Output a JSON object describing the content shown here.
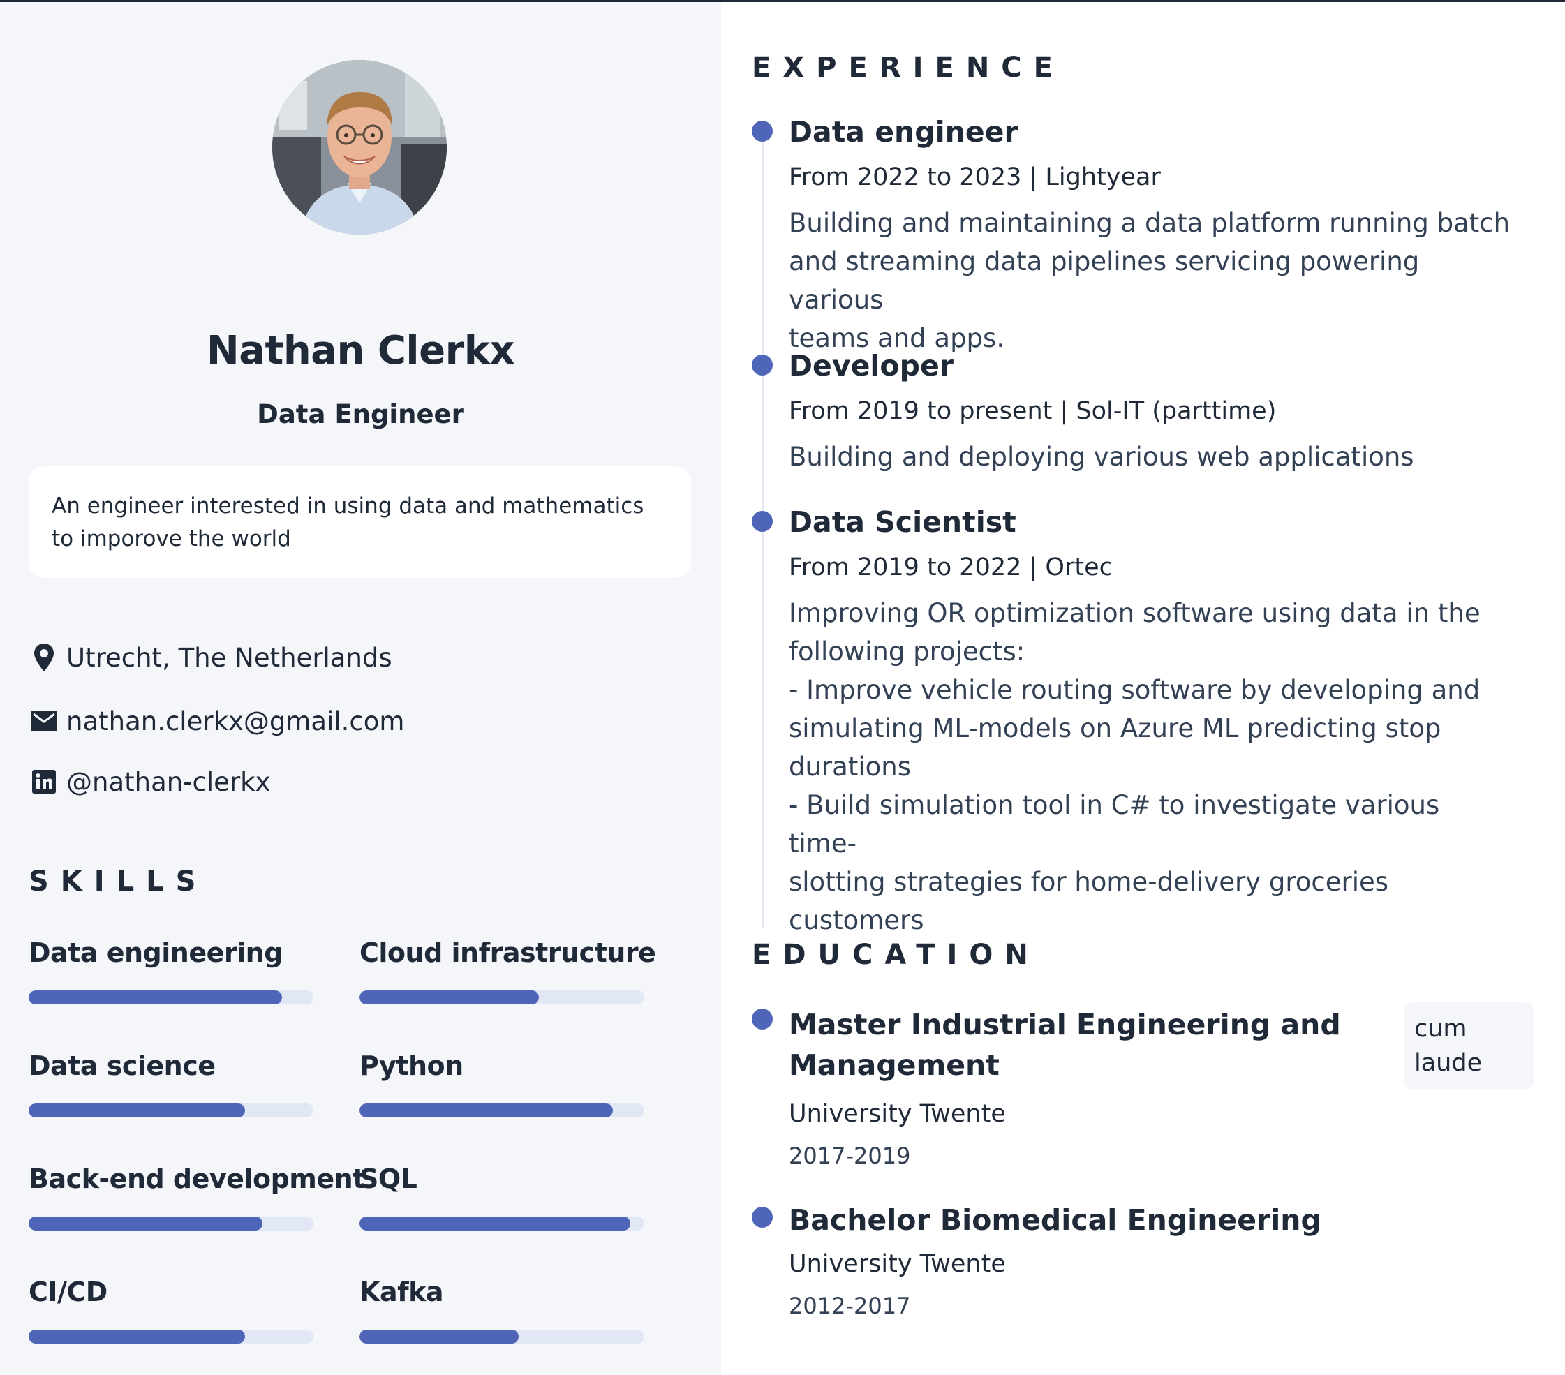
{
  "profile": {
    "name": "Nathan Clerkx",
    "role": "Data Engineer",
    "about": "An engineer interested in using data and mathematics to imporove the world"
  },
  "contact": {
    "location": "Utrecht, The Netherlands",
    "email": "nathan.clerkx@gmail.com",
    "linkedin": "@nathan-clerkx"
  },
  "skills": {
    "heading": "SKILLS",
    "items": [
      {
        "label": "Data engineering",
        "level": 0.89
      },
      {
        "label": "Cloud infrastructure",
        "level": 0.63
      },
      {
        "label": "Data science",
        "level": 0.76
      },
      {
        "label": "Python",
        "level": 0.89
      },
      {
        "label": "Back-end development",
        "level": 0.82
      },
      {
        "label": "SQL",
        "level": 0.95
      },
      {
        "label": "CI/CD",
        "level": 0.76
      },
      {
        "label": "Kafka",
        "level": 0.56
      }
    ]
  },
  "experience": {
    "heading": "EXPERIENCE",
    "jobs": [
      {
        "title": "Data engineer",
        "meta": "From 2022 to 2023 | Lightyear",
        "description": "Building and maintaining a data platform running batch\nand streaming data pipelines servicing powering various\nteams and apps."
      },
      {
        "title": "Developer",
        "meta": "From 2019 to present | Sol-IT (parttime)",
        "description": "Building and deploying various web applications"
      },
      {
        "title": "Data Scientist",
        "meta": "From 2019 to 2022 | Ortec",
        "description": "Improving OR optimization software using data in the\nfollowing projects:\n- Improve vehicle routing software by developing and\nsimulating ML-models on Azure ML predicting stop\ndurations\n- Build simulation tool in C# to investigate various time-\nslotting strategies for home-delivery groceries customers"
      }
    ]
  },
  "education": {
    "heading": "EDUCATION",
    "items": [
      {
        "title": "Master Industrial Engineering and Management",
        "institution": "University Twente",
        "years": "2017-2019",
        "badge": "cum laude"
      },
      {
        "title": "Bachelor Biomedical Engineering",
        "institution": "University Twente",
        "years": "2012-2017"
      }
    ]
  },
  "icons": [
    "map-pin-icon",
    "mail-icon",
    "linkedin-icon"
  ],
  "colors": {
    "accent": "#4f66b8",
    "track": "#e1e7f4",
    "panel": "#f4f6fa",
    "text": "#1f2937"
  }
}
